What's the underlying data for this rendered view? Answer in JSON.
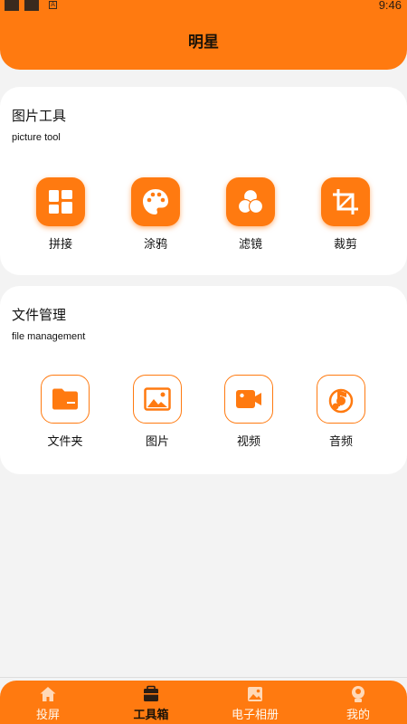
{
  "status_bar": {
    "time": "9:46",
    "notification_badge": "A"
  },
  "header": {
    "title": "明星"
  },
  "picture_tools": {
    "title": "图片工具",
    "subtitle": "picture tool",
    "items": [
      {
        "label": "拼接",
        "icon": "grid-icon"
      },
      {
        "label": "涂鸦",
        "icon": "palette-icon"
      },
      {
        "label": "滤镜",
        "icon": "filter-icon"
      },
      {
        "label": "裁剪",
        "icon": "crop-icon"
      }
    ]
  },
  "file_management": {
    "title": "文件管理",
    "subtitle": "file management",
    "items": [
      {
        "label": "文件夹",
        "icon": "folder-icon"
      },
      {
        "label": "图片",
        "icon": "image-icon"
      },
      {
        "label": "视频",
        "icon": "video-icon"
      },
      {
        "label": "音频",
        "icon": "music-icon"
      }
    ]
  },
  "bottom_nav": {
    "active": "工具箱",
    "items": [
      {
        "label": "投屏",
        "icon": "home-icon"
      },
      {
        "label": "工具箱",
        "icon": "toolbox-icon"
      },
      {
        "label": "电子相册",
        "icon": "album-icon"
      },
      {
        "label": "我的",
        "icon": "profile-icon"
      }
    ]
  },
  "colors": {
    "accent": "#ff7a10",
    "background": "#f3f3f3",
    "card": "#ffffff"
  }
}
